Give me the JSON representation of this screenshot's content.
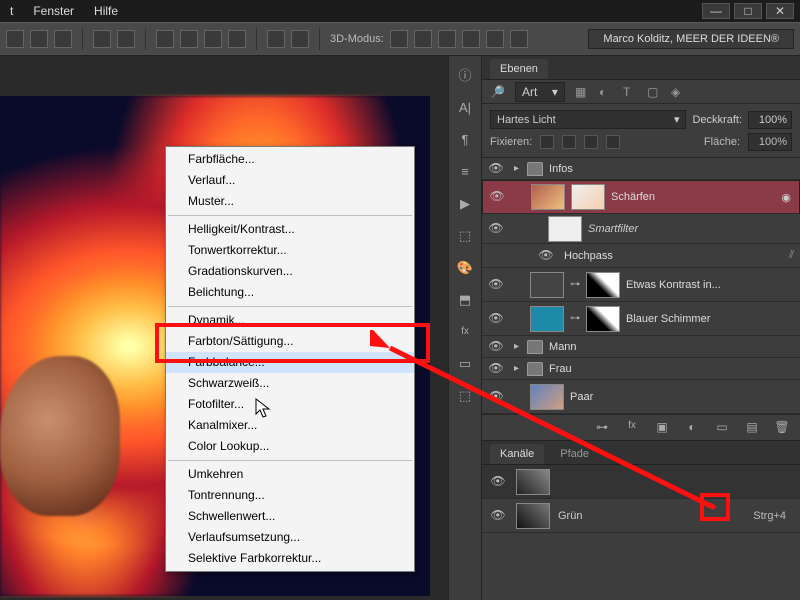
{
  "menu": {
    "items": [
      "t",
      "Fenster",
      "Hilfe"
    ]
  },
  "window_controls": {
    "min": "—",
    "max": "□",
    "close": "✕"
  },
  "options_bar": {
    "mode_label": "3D-Modus:",
    "credit": "Marco Kolditz, MEER DER IDEEN®"
  },
  "context_menu": {
    "groups": [
      [
        "Farbfläche...",
        "Verlauf...",
        "Muster..."
      ],
      [
        "Helligkeit/Kontrast...",
        "Tonwertkorrektur...",
        "Gradationskurven...",
        "Belichtung..."
      ],
      [
        "Dynamik...",
        "Farbton/Sättigung...",
        "Farbbalance...",
        "Schwarzweiß...",
        "Fotofilter...",
        "Kanalmixer...",
        "Color Lookup..."
      ],
      [
        "Umkehren",
        "Tontrennung...",
        "Schwellenwert...",
        "Verlaufsumsetzung...",
        "Selektive Farbkorrektur..."
      ]
    ],
    "hover_index": [
      2,
      2
    ]
  },
  "layers_panel": {
    "tab": "Ebenen",
    "filter_label": "Art",
    "blend_mode": "Hartes Licht",
    "opacity_label": "Deckkraft:",
    "opacity_value": "100%",
    "lock_label": "Fixieren:",
    "fill_label": "Fläche:",
    "fill_value": "100%",
    "layers": [
      {
        "type": "group",
        "name": "Infos",
        "expanded": false
      },
      {
        "type": "smart",
        "name": "Schärfen",
        "selected": true
      },
      {
        "type": "smartfilter_header",
        "name": "Smartfilter"
      },
      {
        "type": "smartfilter_item",
        "name": "Hochpass"
      },
      {
        "type": "adjust",
        "name": "Etwas Kontrast in..."
      },
      {
        "type": "adjust",
        "name": "Blauer Schimmer"
      },
      {
        "type": "group",
        "name": "Mann",
        "expanded": false
      },
      {
        "type": "group",
        "name": "Frau",
        "expanded": false
      },
      {
        "type": "image",
        "name": "Paar"
      }
    ]
  },
  "channels_panel": {
    "tabs": [
      "Kanäle",
      "Pfade"
    ],
    "channel": {
      "name": "Grün",
      "shortcut": "Strg+4"
    }
  }
}
